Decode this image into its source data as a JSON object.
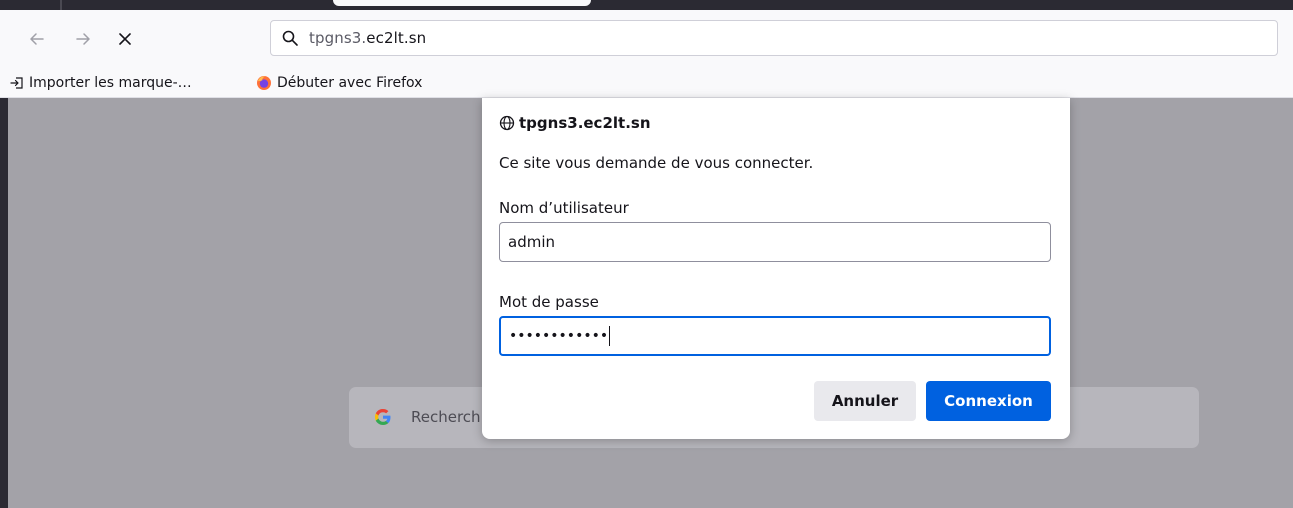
{
  "browser": {
    "url_subdomain": "tpgns3.",
    "url_domain": "ec2lt.sn",
    "nav_icons": [
      "back-arrow-icon",
      "forward-arrow-icon",
      "close-icon",
      "search-icon"
    ]
  },
  "bookmarks": [
    {
      "label": "Importer les marque-…",
      "icon": "import-icon"
    },
    {
      "label": "Débuter avec Firefox",
      "icon": "firefox-icon"
    }
  ],
  "page": {
    "search_placeholder": "Recherch",
    "search_icon": "google-icon"
  },
  "dialog": {
    "site": "tpgns3.ec2lt.sn",
    "site_icon": "globe-icon",
    "message": "Ce site vous demande de vous connecter.",
    "username_label": "Nom d’utilisateur",
    "username_value": "admin",
    "password_label": "Mot de passe",
    "password_value": "••••••••••••",
    "cancel_label": "Annuler",
    "submit_label": "Connexion"
  },
  "colors": {
    "accent": "#0061e0",
    "overlay": "#a3a2a8",
    "toolbar": "#f9f9fb"
  }
}
